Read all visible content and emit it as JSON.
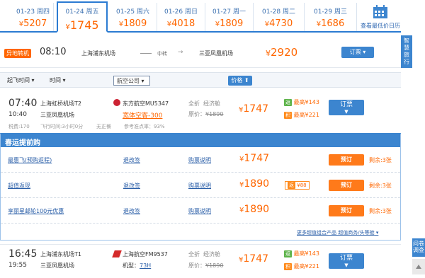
{
  "dates": [
    {
      "date": "01-23 周四",
      "price": "5207"
    },
    {
      "date": "01-24 周五",
      "price": "1745"
    },
    {
      "date": "01-25 周六",
      "price": "1809"
    },
    {
      "date": "01-26 周日",
      "price": "4018"
    },
    {
      "date": "01-27 周一",
      "price": "1809"
    },
    {
      "date": "01-28 周二",
      "price": "4730"
    },
    {
      "date": "01-29 周三",
      "price": "1686"
    }
  ],
  "currency": "¥",
  "calendar_label": "查看最低价日历",
  "side_bar": "智慧旅行",
  "transfer": {
    "badge": "异地转机",
    "time": "08:10",
    "from": "上海浦东机场",
    "via": "中转",
    "to": "三亚凤凰机场",
    "price": "2920",
    "book": "订票"
  },
  "filters": {
    "depart_time": "起飞时间",
    "time_slot": "时间",
    "airline": "航空公司",
    "price_sort": "价格 ⬆"
  },
  "flight1": {
    "dep_time": "07:40",
    "dep_airport": "上海虹桥机场T2",
    "arr_time": "10:40",
    "arr_airport": "三亚凤凰机场",
    "airline": "东方航空MU5347",
    "promo": "宽体空客-300",
    "discount": "全折",
    "cabin": "经济舱",
    "orig_label": "原价：",
    "orig_price": "¥1890",
    "price": "1747",
    "cashback1_label": "最高",
    "cashback1": "¥143",
    "cashback2_label": "最高",
    "cashback2": "¥221",
    "book": "订票",
    "tax": "税费:170",
    "duration": "飞行时间:3小时0分",
    "meal": "无正餐",
    "ontime": "参考准点率：93%"
  },
  "promo": {
    "title": "春运提前购",
    "rows": [
      {
        "name": "最惠飞(预购返程)",
        "rule": "退改签",
        "desc": "购票说明",
        "price": "1747",
        "tag": "",
        "book": "预订",
        "left": "剩余:3张"
      },
      {
        "name": "超值返现",
        "rule": "退改签",
        "desc": "购票说明",
        "price": "1890",
        "tag": "¥88",
        "book": "预订",
        "left": "剩余:3张"
      },
      {
        "name": "享丽星邮轮100元优惠",
        "rule": "退改签",
        "desc": "购票说明",
        "price": "1890",
        "tag": "",
        "book": "预订",
        "left": "剩余:3张"
      }
    ],
    "more": "更多超值组合产品 超值商务/头等舱"
  },
  "flight2": {
    "dep_time": "16:45",
    "dep_airport": "上海浦东机场T1",
    "arr_time": "19:55",
    "arr_airport": "三亚凤凰机场",
    "airline": "上海航空FM9537",
    "model_label": "机型：",
    "model": "73H",
    "discount": "全折",
    "cabin": "经济舱",
    "orig_label": "原价：",
    "orig_price": "¥1890",
    "price": "1747",
    "cashback1_label": "最高",
    "cashback1": "¥143",
    "cashback2_label": "最高",
    "cashback2": "¥221",
    "book": "订票"
  },
  "feedback": "问卷调查",
  "colors": {
    "accent": "#3c85cf",
    "price": "#ff6600",
    "link": "#2b5fa8"
  }
}
